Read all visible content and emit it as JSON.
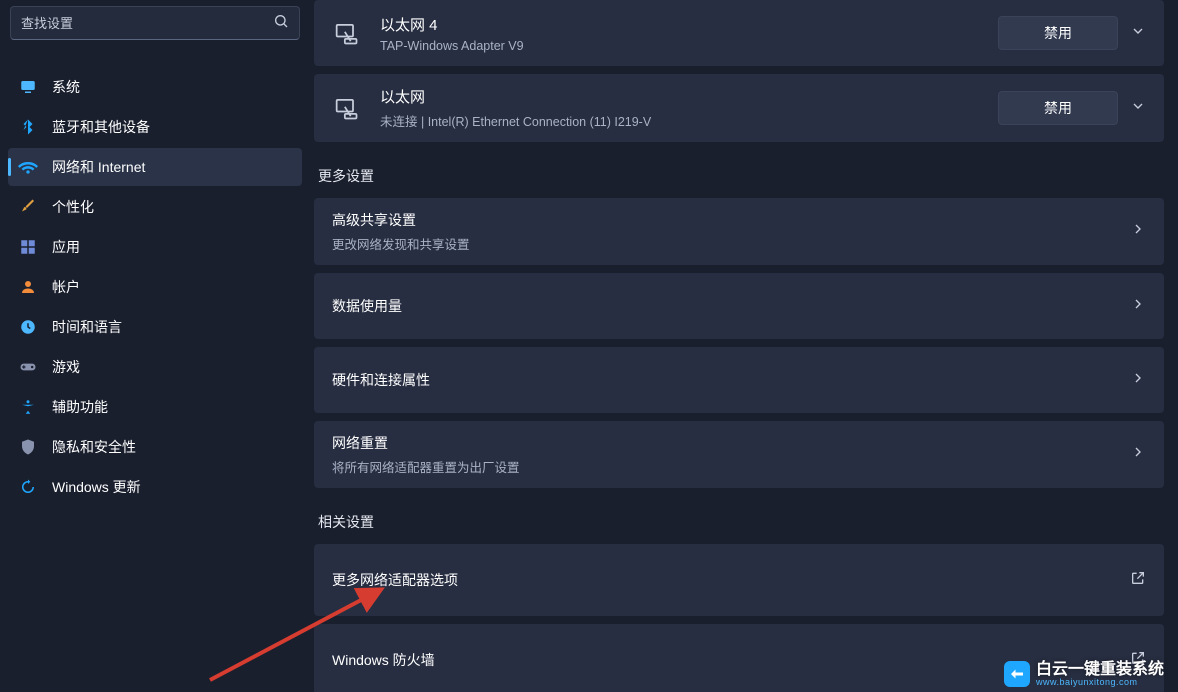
{
  "sidebar": {
    "search_placeholder": "查找设置",
    "items": [
      {
        "icon": "monitor",
        "label": "系统"
      },
      {
        "icon": "bluetooth",
        "label": "蓝牙和其他设备"
      },
      {
        "icon": "wifi",
        "label": "网络和 Internet",
        "active": true
      },
      {
        "icon": "brush",
        "label": "个性化"
      },
      {
        "icon": "apps",
        "label": "应用"
      },
      {
        "icon": "account",
        "label": "帐户"
      },
      {
        "icon": "clock",
        "label": "时间和语言"
      },
      {
        "icon": "gamepad",
        "label": "游戏"
      },
      {
        "icon": "accessibility",
        "label": "辅助功能"
      },
      {
        "icon": "shield",
        "label": "隐私和安全性"
      },
      {
        "icon": "update",
        "label": "Windows 更新"
      }
    ]
  },
  "main": {
    "adapters": [
      {
        "title": "以太网 4",
        "subtitle": "TAP-Windows Adapter V9",
        "button": "禁用"
      },
      {
        "title": "以太网",
        "subtitle": "未连接 | Intel(R) Ethernet Connection (11) I219-V",
        "button": "禁用"
      }
    ],
    "sections": {
      "more": {
        "heading": "更多设置",
        "items": [
          {
            "title": "高级共享设置",
            "subtitle": "更改网络发现和共享设置"
          },
          {
            "title": "数据使用量"
          },
          {
            "title": "硬件和连接属性"
          },
          {
            "title": "网络重置",
            "subtitle": "将所有网络适配器重置为出厂设置"
          }
        ]
      },
      "related": {
        "heading": "相关设置",
        "items": [
          {
            "title": "更多网络适配器选项",
            "ext": true
          },
          {
            "title": "Windows 防火墙",
            "ext": true
          }
        ]
      }
    }
  },
  "watermark": {
    "line1": "白云一键重装系统",
    "line2": "www.baiyunxitong.com"
  }
}
